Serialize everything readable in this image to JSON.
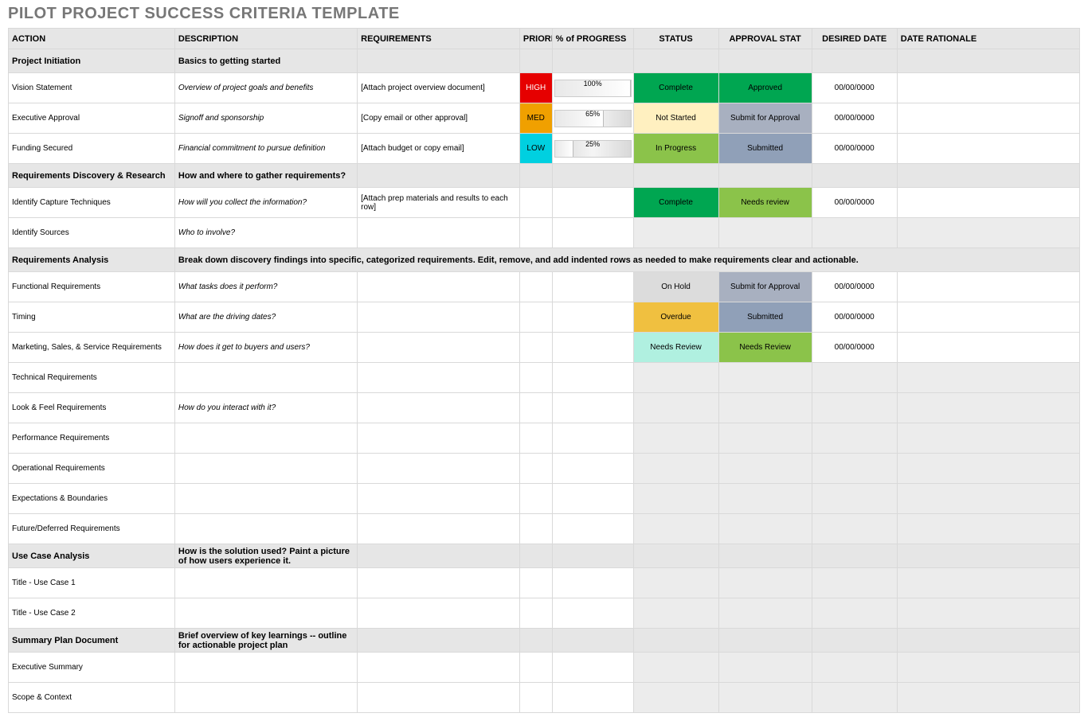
{
  "title": "PILOT PROJECT SUCCESS CRITERIA TEMPLATE",
  "columns": [
    "ACTION",
    "DESCRIPTION",
    "REQUIREMENTS",
    "PRIORITY",
    "% of PROGRESS",
    "STATUS",
    "APPROVAL STAT",
    "DESIRED DATE",
    "DATE RATIONALE"
  ],
  "rows": [
    {
      "type": "section",
      "action": "Project Initiation",
      "description": "Basics to getting started"
    },
    {
      "type": "item",
      "action": "Vision Statement",
      "description": "Overview of project goals and benefits",
      "requirements": "[Attach project overview document]",
      "priority": "HIGH",
      "progress": 100,
      "status": "Complete",
      "approval": "Approved",
      "date": "00/00/0000"
    },
    {
      "type": "item",
      "action": "Executive Approval",
      "description": "Signoff and sponsorship",
      "requirements": "[Copy email or other approval]",
      "priority": "MED",
      "progress": 65,
      "status": "Not Started",
      "approval": "Submit for Approval",
      "date": "00/00/0000"
    },
    {
      "type": "item",
      "action": "Funding Secured",
      "description": "Financial commitment to pursue definition",
      "requirements": "[Attach budget or copy email]",
      "priority": "LOW",
      "progress": 25,
      "status": "In Progress",
      "approval": "Submitted",
      "date": "00/00/0000"
    },
    {
      "type": "section",
      "action": "Requirements Discovery & Research",
      "description": "How and where to gather requirements?"
    },
    {
      "type": "item",
      "action": "Identify Capture Techniques",
      "description": "How will you collect the information?",
      "requirements": "[Attach prep materials and results to each row]",
      "status": "Complete",
      "approval": "Needs review",
      "date": "00/00/0000"
    },
    {
      "type": "item",
      "action": "Identify Sources",
      "description": "Who to involve?",
      "emptyGrayTail": true
    },
    {
      "type": "section",
      "action": "Requirements Analysis",
      "description": "Break down discovery findings into specific, categorized requirements. Edit, remove, and add indented rows as needed to make requirements clear and actionable.",
      "fullDesc": true
    },
    {
      "type": "item",
      "action": "Functional Requirements",
      "description": "What tasks does it perform?",
      "status": "On Hold",
      "approval": "Submit for Approval",
      "date": "00/00/0000"
    },
    {
      "type": "item",
      "action": "Timing",
      "description": "What are the driving dates?",
      "status": "Overdue",
      "approval": "Submitted",
      "date": "00/00/0000"
    },
    {
      "type": "item",
      "action": "Marketing, Sales, & Service Requirements",
      "description": "How does it get to buyers and users?",
      "status": "Needs Review",
      "approval": "Needs Review",
      "date": "00/00/0000"
    },
    {
      "type": "item",
      "action": "Technical Requirements",
      "emptyGrayTail": true
    },
    {
      "type": "item",
      "action": "Look & Feel Requirements",
      "description": "How do you interact with it?",
      "emptyGrayTail": true
    },
    {
      "type": "item",
      "action": "Performance Requirements",
      "emptyGrayTail": true
    },
    {
      "type": "item",
      "action": "Operational Requirements",
      "emptyGrayTail": true
    },
    {
      "type": "item",
      "action": "Expectations & Boundaries",
      "emptyGrayTail": true
    },
    {
      "type": "item",
      "action": "Future/Deferred Requirements",
      "emptyGrayTail": true
    },
    {
      "type": "section",
      "action": "Use Case Analysis",
      "description": "How is the solution used? Paint a picture of how users experience it."
    },
    {
      "type": "item",
      "action": "Title - Use Case 1",
      "emptyGrayTail": true
    },
    {
      "type": "item",
      "action": "Title - Use Case 2",
      "emptyGrayTail": true
    },
    {
      "type": "section",
      "action": "Summary Plan Document",
      "description": "Brief overview of key learnings -- outline for actionable project plan"
    },
    {
      "type": "item",
      "action": "Executive Summary",
      "emptyGrayTail": true
    },
    {
      "type": "item",
      "action": "Scope & Context",
      "emptyGrayTail": true
    }
  ]
}
